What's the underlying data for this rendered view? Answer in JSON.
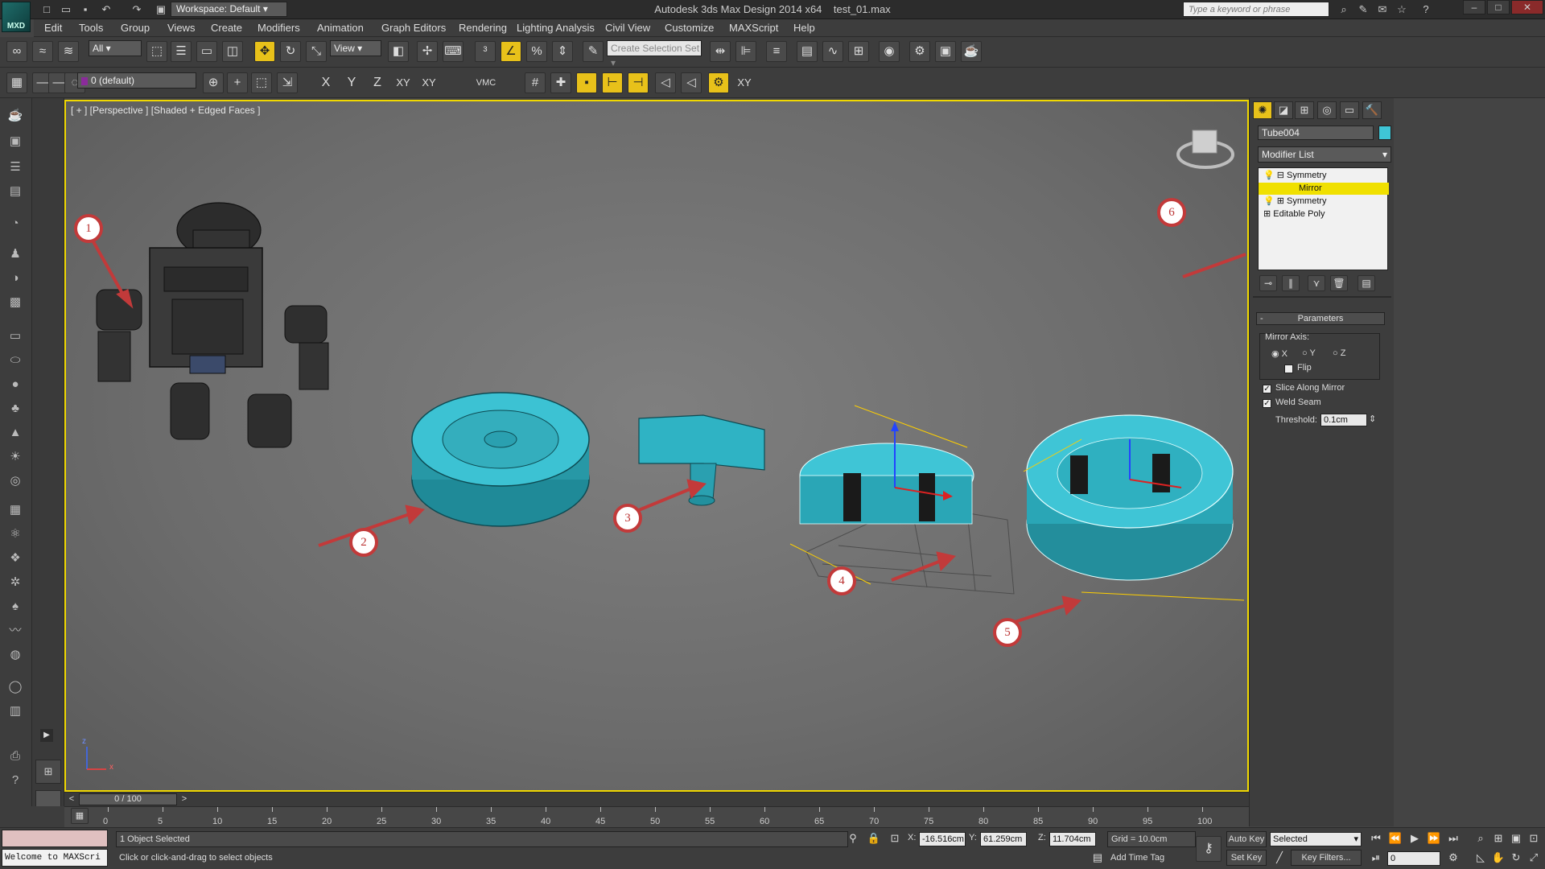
{
  "title": {
    "app": "Autodesk 3ds Max Design 2014 x64",
    "file": "test_01.max",
    "workspace": "Workspace: Default",
    "search_placeholder": "Type a keyword or phrase",
    "logo": "MXD"
  },
  "menu": [
    "Edit",
    "Tools",
    "Group",
    "Views",
    "Create",
    "Modifiers",
    "Animation",
    "Graph Editors",
    "Rendering",
    "Lighting Analysis",
    "Civil View",
    "Customize",
    "MAXScript",
    "Help"
  ],
  "toolbar1": {
    "filter": "All",
    "refcoord": "View",
    "named_selection_placeholder": "Create Selection Set"
  },
  "toolbar2": {
    "layer": "0 (default)",
    "axes": [
      "X",
      "Y",
      "Z",
      "XY",
      "XY"
    ],
    "vmc": "VMC",
    "xy_last": "XY"
  },
  "viewport": {
    "label": "[ + ] [Perspective ] [Shaded + Edged Faces ]",
    "markers": [
      "1",
      "2",
      "3",
      "4",
      "5",
      "6"
    ],
    "axis_x": "x",
    "axis_z": "z"
  },
  "command_panel": {
    "object_name": "Tube004",
    "object_color": "#3fc5d6",
    "modifier_list": "Modifier List",
    "stack": [
      {
        "label": "Symmetry",
        "expand": "⊟"
      },
      {
        "label": "Mirror",
        "expand": ""
      },
      {
        "label": "Symmetry",
        "expand": "⊞"
      },
      {
        "label": "Editable Poly",
        "expand": "⊞"
      }
    ],
    "parameters": {
      "title": "Parameters",
      "collapse": "-",
      "mirror_axis_label": "Mirror Axis:",
      "axes": [
        "X",
        "Y",
        "Z"
      ],
      "selected_axis": "X",
      "flip": "Flip",
      "flip_checked": false,
      "slice": "Slice Along Mirror",
      "slice_checked": true,
      "weld": "Weld Seam",
      "weld_checked": true,
      "threshold_label": "Threshold:",
      "threshold_value": "0.1cm"
    }
  },
  "timeline": {
    "frame": "0 / 100",
    "ticks": [
      "0",
      "5",
      "10",
      "15",
      "20",
      "25",
      "30",
      "35",
      "40",
      "45",
      "50",
      "55",
      "60",
      "65",
      "70",
      "75",
      "80",
      "85",
      "90",
      "95",
      "100"
    ]
  },
  "status": {
    "maxscript": "Welcome to MAXScri",
    "selection": "1 Object Selected",
    "prompt": "Click or click-and-drag to select objects",
    "x_label": "X:",
    "x": "-16.516cm",
    "y_label": "Y:",
    "y": "61.259cm",
    "z_label": "Z:",
    "z": "11.704cm",
    "grid": "Grid = 10.0cm",
    "add_time_tag": "Add Time Tag",
    "auto_key": "Auto Key",
    "set_key": "Set Key",
    "selected": "Selected",
    "key_filters": "Key Filters...",
    "frame_value": "0"
  },
  "colors": {
    "accent": "#f0d800",
    "teal": "#3fc5d6",
    "marker": "#c23a3a"
  }
}
